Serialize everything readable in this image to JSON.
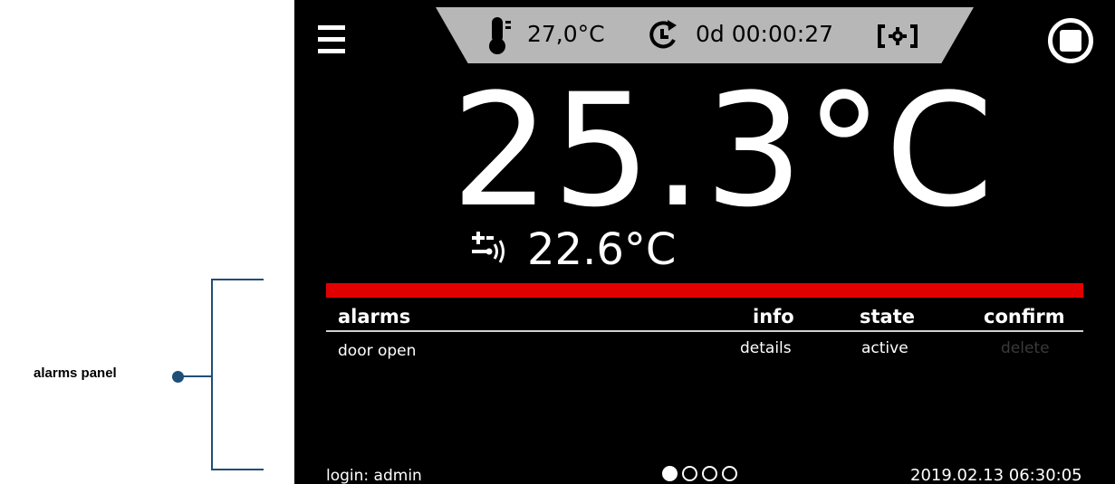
{
  "annotation": {
    "label": "alarms panel"
  },
  "status_bar": {
    "set_temperature": "27,0°C",
    "timer": "0d 00:00:27"
  },
  "main": {
    "current_temperature": "25.3°C",
    "secondary_temperature": "22.6°C"
  },
  "alarms_table": {
    "headers": {
      "alarms": "alarms",
      "info": "info",
      "state": "state",
      "confirm": "confirm"
    },
    "rows": [
      {
        "alarm": "door open",
        "info": "details",
        "state": "active",
        "confirm": "delete"
      }
    ]
  },
  "footer": {
    "login": "login: admin",
    "page_dots": 4,
    "active_page": 1,
    "datetime": "2019.02.13  06:30:05"
  },
  "colors": {
    "accent_alarm_bar": "#e00000",
    "status_bar_bg": "#b7b7b7",
    "annotation": "#1f4e79"
  },
  "icons": [
    "menu-icon",
    "thermometer-icon",
    "timer-icon",
    "camera-settings-icon",
    "stop-icon",
    "sensor-icon"
  ]
}
